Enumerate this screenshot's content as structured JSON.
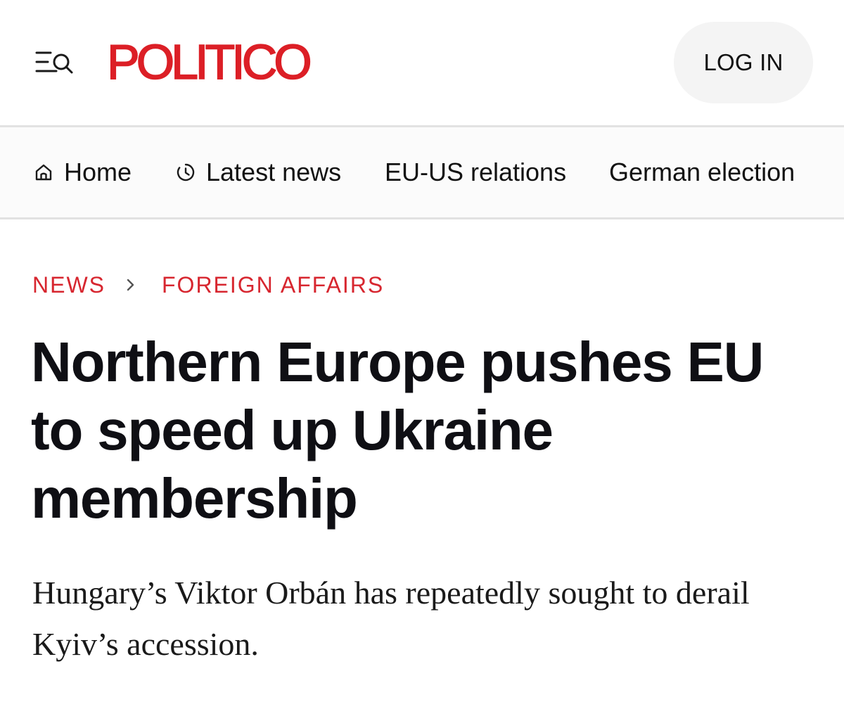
{
  "header": {
    "logo_text": "POLITICO",
    "logo_color": "#dc1f26",
    "menu_icon": "menu-search-icon",
    "login_label": "LOG IN"
  },
  "nav": {
    "items": [
      {
        "label": "Home",
        "icon": "home-icon"
      },
      {
        "label": "Latest news",
        "icon": "clock-icon"
      },
      {
        "label": "EU-US relations"
      },
      {
        "label": "German election"
      }
    ]
  },
  "article": {
    "breadcrumb": [
      {
        "label": "NEWS"
      },
      {
        "label": "FOREIGN AFFAIRS"
      }
    ],
    "breadcrumb_color": "#d7262f",
    "headline": "Northern Europe pushes EU to speed up Ukraine membership",
    "dek": "Hungary’s Viktor Orbán has repeatedly sought to derail Kyiv’s accession."
  }
}
